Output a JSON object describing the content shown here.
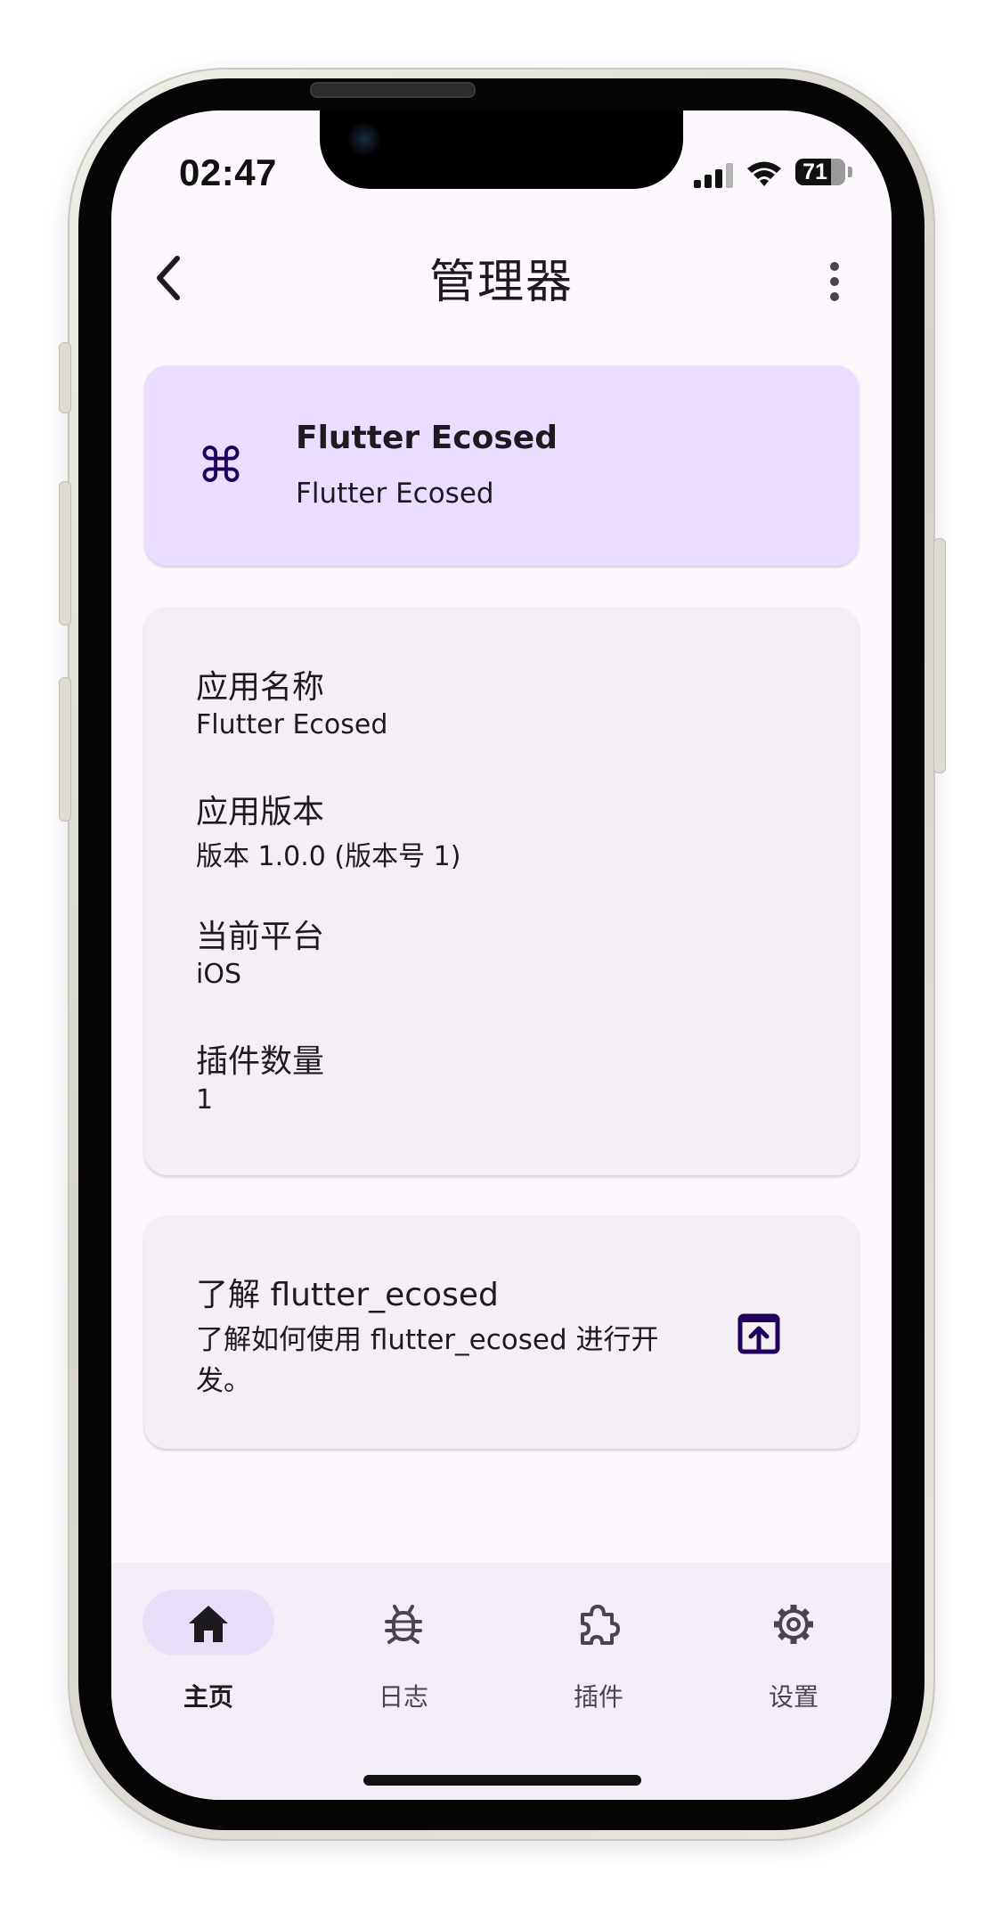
{
  "status_bar": {
    "time": "02:47",
    "battery": "71"
  },
  "app_bar": {
    "title": "管理器"
  },
  "primary_card": {
    "title": "Flutter Ecosed",
    "subtitle": "Flutter Ecosed",
    "icon": "command-icon"
  },
  "info_card": {
    "items": [
      {
        "label": "应用名称",
        "value": "Flutter Ecosed"
      },
      {
        "label": "应用版本",
        "value": "版本 1.0.0 (版本号 1)"
      },
      {
        "label": "当前平台",
        "value": "iOS"
      },
      {
        "label": "插件数量",
        "value": "1"
      }
    ]
  },
  "learn_card": {
    "title": "了解 flutter_ecosed",
    "description": "了解如何使用 flutter_ecosed 进行开发。",
    "icon": "open-in-browser-icon"
  },
  "bottom_nav": {
    "items": [
      {
        "label": "主页",
        "icon": "home-icon",
        "selected": true
      },
      {
        "label": "日志",
        "icon": "bug-icon",
        "selected": false
      },
      {
        "label": "插件",
        "icon": "extension-icon",
        "selected": false
      },
      {
        "label": "设置",
        "icon": "settings-icon",
        "selected": false
      }
    ]
  },
  "colors": {
    "background": "#fdf7fe",
    "primary_container": "#eaddff",
    "surface_container": "#f4eff4",
    "nav_background": "#f3edf7",
    "nav_indicator": "#e8def8",
    "icon_accent": "#21005d"
  }
}
